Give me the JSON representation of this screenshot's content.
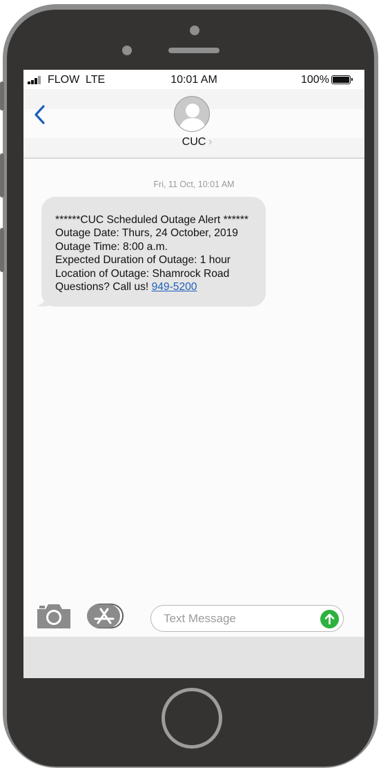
{
  "status_bar": {
    "carrier": "FLOW",
    "network": "LTE",
    "time": "10:01 AM",
    "battery": "100%"
  },
  "header": {
    "contact_name": "CUC"
  },
  "conversation": {
    "timestamp": "Fri, 11 Oct, 10:01 AM",
    "message": {
      "lines": [
        "******CUC Scheduled Outage Alert ******",
        "Outage Date: Thurs, 24 October, 2019",
        "Outage Time: 8:00 a.m.",
        "Expected Duration of Outage: 1 hour",
        "Location of Outage: Shamrock Road"
      ],
      "last_line_prefix": "Questions? Call us!",
      "phone_link": "949-5200"
    }
  },
  "composer": {
    "placeholder": "Text Message"
  },
  "icons": {
    "back": "chevron-left-icon",
    "avatar": "person-icon",
    "camera": "camera-icon",
    "apps": "app-store-icon",
    "send": "arrow-up-icon"
  },
  "colors": {
    "accent": "#1e5fbb",
    "send": "#2db23f",
    "bubble": "#e5e5e5",
    "frame": "#353331"
  }
}
